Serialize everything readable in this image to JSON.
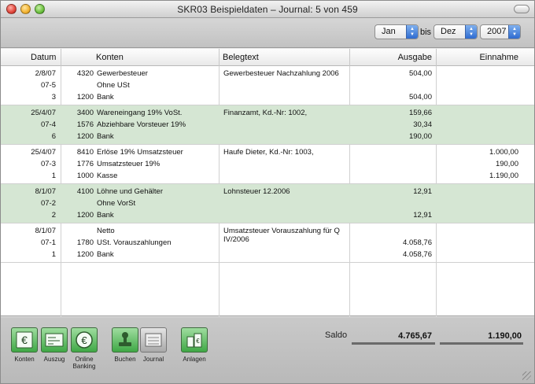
{
  "window": {
    "title": "SKR03 Beispieldaten – Journal: 5 von 459"
  },
  "filter": {
    "from_month": "Jan",
    "bis_label": "bis",
    "to_month": "Dez",
    "year": "2007"
  },
  "columns": {
    "datum": "Datum",
    "konten": "Konten",
    "belegtext": "Belegtext",
    "ausgabe": "Ausgabe",
    "einnahme": "Einnahme"
  },
  "entries": [
    {
      "shaded": false,
      "lines": [
        {
          "datum": "2/8/07",
          "nr": "4320",
          "konto": "Gewerbesteuer",
          "beleg": "Gewerbesteuer Nachzahlung 2006",
          "ausgabe": "504,00",
          "einnahme": ""
        },
        {
          "datum": "07-5",
          "nr": "",
          "konto": "Ohne USt",
          "beleg": "",
          "ausgabe": "",
          "einnahme": ""
        },
        {
          "datum": "3",
          "nr": "1200",
          "konto": "Bank",
          "beleg": "",
          "ausgabe": "504,00",
          "einnahme": ""
        }
      ]
    },
    {
      "shaded": true,
      "lines": [
        {
          "datum": "25/4/07",
          "nr": "3400",
          "konto": "Wareneingang 19% VoSt.",
          "beleg": "Finanzamt, Kd.-Nr: 1002,",
          "ausgabe": "159,66",
          "einnahme": ""
        },
        {
          "datum": "07-4",
          "nr": "1576",
          "konto": "Abziehbare Vorsteuer 19%",
          "beleg": "",
          "ausgabe": "30,34",
          "einnahme": ""
        },
        {
          "datum": "6",
          "nr": "1200",
          "konto": "Bank",
          "beleg": "",
          "ausgabe": "190,00",
          "einnahme": ""
        }
      ]
    },
    {
      "shaded": false,
      "lines": [
        {
          "datum": "25/4/07",
          "nr": "8410",
          "konto": "Erlöse 19% Umsatzsteuer",
          "beleg": "Haufe Dieter, Kd.-Nr: 1003,",
          "ausgabe": "",
          "einnahme": "1.000,00"
        },
        {
          "datum": "07-3",
          "nr": "1776",
          "konto": "Umsatzsteuer 19%",
          "beleg": "",
          "ausgabe": "",
          "einnahme": "190,00"
        },
        {
          "datum": "1",
          "nr": "1000",
          "konto": "Kasse",
          "beleg": "",
          "ausgabe": "",
          "einnahme": "1.190,00"
        }
      ]
    },
    {
      "shaded": true,
      "lines": [
        {
          "datum": "8/1/07",
          "nr": "4100",
          "konto": "Löhne und Gehälter",
          "beleg": "Lohnsteuer 12.2006",
          "ausgabe": "12,91",
          "einnahme": ""
        },
        {
          "datum": "07-2",
          "nr": "",
          "konto": "Ohne VorSt",
          "beleg": "",
          "ausgabe": "",
          "einnahme": ""
        },
        {
          "datum": "2",
          "nr": "1200",
          "konto": "Bank",
          "beleg": "",
          "ausgabe": "12,91",
          "einnahme": ""
        }
      ]
    },
    {
      "shaded": false,
      "lines": [
        {
          "datum": "8/1/07",
          "nr": "",
          "konto": "Netto",
          "beleg": "Umsatzsteuer Vorauszahlung für Q IV/2006",
          "ausgabe": "",
          "einnahme": ""
        },
        {
          "datum": "07-1",
          "nr": "1780",
          "konto": "USt. Vorauszahlungen",
          "beleg": "",
          "ausgabe": "4.058,76",
          "einnahme": ""
        },
        {
          "datum": "1",
          "nr": "1200",
          "konto": "Bank",
          "beleg": "",
          "ausgabe": "4.058,76",
          "einnahme": ""
        }
      ]
    }
  ],
  "toolbar": {
    "konten": "Konten",
    "auszug": "Auszug",
    "online_banking": "Online Banking",
    "buchen": "Buchen",
    "journal": "Journal",
    "anlagen": "Anlagen"
  },
  "saldo": {
    "label": "Saldo",
    "ausgabe": "4.765,67",
    "einnahme": "1.190,00"
  }
}
